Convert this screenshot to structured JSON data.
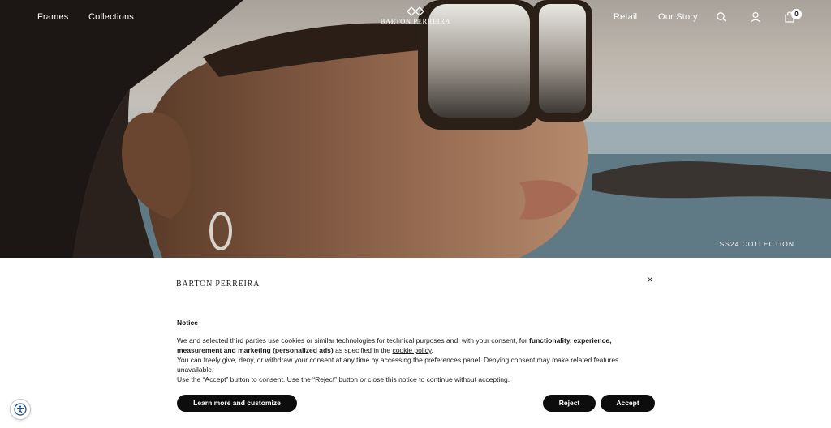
{
  "header": {
    "nav_left": [
      {
        "label": "Frames"
      },
      {
        "label": "Collections"
      }
    ],
    "logo_text": "BARTON PERREIRA",
    "nav_right": [
      {
        "label": "Retail"
      },
      {
        "label": "Our Story"
      }
    ],
    "icons": {
      "search": "search-icon",
      "account": "user-icon",
      "cart": "cart-icon"
    },
    "cart_count": "0"
  },
  "hero": {
    "collection_label": "SS24 COLLECTION"
  },
  "cookie_banner": {
    "brand": "BARTON PERREIRA",
    "close_label": "×",
    "title": "Notice",
    "body": {
      "p1_a": "We and selected third parties use cookies or similar technologies for technical purposes and, with your consent, for ",
      "p1_bold": "functionality, experience, measurement and marketing (personalized ads)",
      "p1_b": " as specified in the ",
      "p1_link": "cookie policy",
      "p1_c": ".",
      "p2": "You can freely give, deny, or withdraw your consent at any time by accessing the preferences panel. Denying consent may make related features unavailable.",
      "p3": "Use the “Accept” button to consent. Use the “Reject” button or close this notice to continue without accepting."
    },
    "buttons": {
      "learn_more": "Learn more and customize",
      "reject": "Reject",
      "accept": "Accept"
    }
  },
  "accessibility": {
    "icon": "accessibility-icon"
  }
}
